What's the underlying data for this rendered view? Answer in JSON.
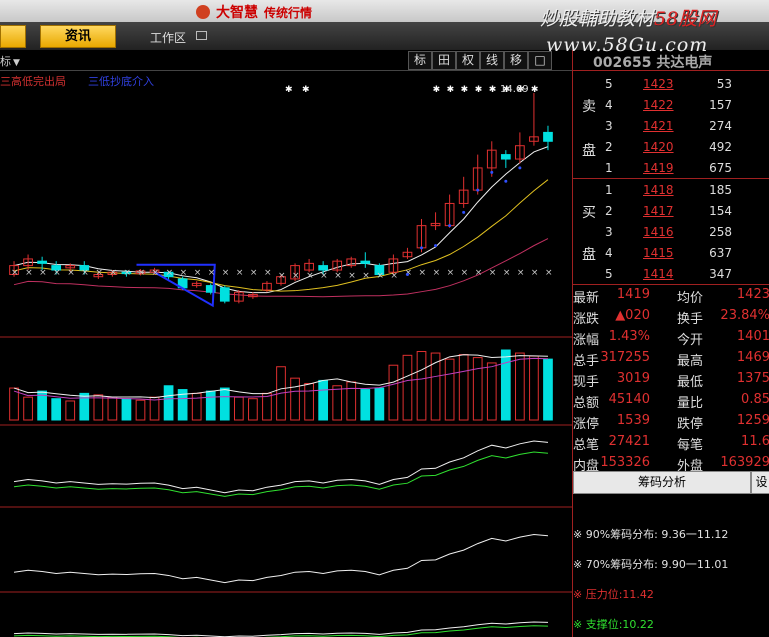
{
  "titlebar": {
    "brand": "大智慧",
    "subtitle": "传统行情"
  },
  "watermark": {
    "line1_a": "炒股輔助教材",
    "line1_b": "58股网",
    "line2": "www.58Gu.com"
  },
  "tabs": {
    "news": "资讯",
    "workzone": "工作区"
  },
  "chart_toolbar": {
    "label": "标",
    "buttons": [
      "标",
      "田",
      "权",
      "线",
      "移",
      "□"
    ]
  },
  "chart_legend": {
    "signal1": "三高低完出局",
    "signal2": "三低抄底介入"
  },
  "chart_annotation": "14.69",
  "colors": {
    "up": "#e03030",
    "down": "#00e0e0",
    "price_red": "#e03030",
    "panel_border": "#a02020"
  },
  "stock": {
    "code": "002655",
    "name": "共达电声"
  },
  "orderbook": {
    "sell_label": [
      "卖",
      "盘"
    ],
    "buy_label": [
      "买",
      "盘"
    ],
    "sell": [
      {
        "level": "5",
        "price": "1423",
        "volume": "53"
      },
      {
        "level": "4",
        "price": "1422",
        "volume": "157"
      },
      {
        "level": "3",
        "price": "1421",
        "volume": "274"
      },
      {
        "level": "2",
        "price": "1420",
        "volume": "492"
      },
      {
        "level": "1",
        "price": "1419",
        "volume": "675"
      }
    ],
    "buy": [
      {
        "level": "1",
        "price": "1418",
        "volume": "185"
      },
      {
        "level": "2",
        "price": "1417",
        "volume": "154"
      },
      {
        "level": "3",
        "price": "1416",
        "volume": "258"
      },
      {
        "level": "4",
        "price": "1415",
        "volume": "637"
      },
      {
        "level": "5",
        "price": "1414",
        "volume": "347"
      }
    ]
  },
  "quotes": [
    {
      "l1": "最新",
      "v1": "1419",
      "l2": "均价",
      "v2": "1423"
    },
    {
      "l1": "涨跌",
      "v1": "▲020",
      "l2": "换手",
      "v2": "23.84%"
    },
    {
      "l1": "涨幅",
      "v1": "1.43%",
      "l2": "今开",
      "v2": "1401"
    },
    {
      "l1": "总手",
      "v1": "317255",
      "l2": "最高",
      "v2": "1469"
    },
    {
      "l1": "现手",
      "v1": "3019",
      "l2": "最低",
      "v2": "1375"
    },
    {
      "l1": "总额",
      "v1": "45140",
      "l2": "量比",
      "v2": "0.85"
    },
    {
      "l1": "涨停",
      "v1": "1539",
      "l2": "跌停",
      "v2": "1259"
    },
    {
      "l1": "总笔",
      "v1": "27421",
      "l2": "每笔",
      "v2": "11.6"
    },
    {
      "l1": "内盘",
      "v1": "153326",
      "l2": "外盘",
      "v2": "163929"
    }
  ],
  "chip": {
    "tab": "筹码分析",
    "settings": "设",
    "lines": [
      {
        "text": "※ 90%筹码分布: 9.36一11.12",
        "color": "#e0e0e0"
      },
      {
        "text": "※ 70%筹码分布: 9.90一11.01",
        "color": "#e0e0e0"
      },
      {
        "text": "※ 压力位:11.42",
        "color": "#e03030"
      },
      {
        "text": "※ 支撑位:10.22",
        "color": "#30e030"
      }
    ]
  },
  "chart_data": {
    "type": "candlestick",
    "candles": [
      [
        10.6,
        10.8,
        10.55,
        10.9
      ],
      [
        10.8,
        10.95,
        10.7,
        11.05
      ],
      [
        10.9,
        10.85,
        10.7,
        11.0
      ],
      [
        10.8,
        10.7,
        10.6,
        10.9
      ],
      [
        10.75,
        10.8,
        10.65,
        10.85
      ],
      [
        10.8,
        10.7,
        10.6,
        10.9
      ],
      [
        10.55,
        10.6,
        10.5,
        10.65
      ],
      [
        10.6,
        10.65,
        10.55,
        10.7
      ],
      [
        10.65,
        10.62,
        10.55,
        10.7
      ],
      [
        10.62,
        10.68,
        10.58,
        10.72
      ],
      [
        10.65,
        10.7,
        10.6,
        10.75
      ],
      [
        10.65,
        10.55,
        10.45,
        10.68
      ],
      [
        10.5,
        10.3,
        10.25,
        10.55
      ],
      [
        10.35,
        10.4,
        10.3,
        10.45
      ],
      [
        10.35,
        10.2,
        10.15,
        10.4
      ],
      [
        10.3,
        10.0,
        9.95,
        10.35
      ],
      [
        10.0,
        10.2,
        9.95,
        10.25
      ],
      [
        10.1,
        10.15,
        10.05,
        10.2
      ],
      [
        10.25,
        10.4,
        10.2,
        10.45
      ],
      [
        10.4,
        10.55,
        10.35,
        10.6
      ],
      [
        10.5,
        10.8,
        10.45,
        10.85
      ],
      [
        10.7,
        10.85,
        10.65,
        10.95
      ],
      [
        10.8,
        10.7,
        10.6,
        10.9
      ],
      [
        10.7,
        10.9,
        10.65,
        10.95
      ],
      [
        10.8,
        10.95,
        10.75,
        11.0
      ],
      [
        10.9,
        10.85,
        10.75,
        11.1
      ],
      [
        10.8,
        10.6,
        10.55,
        10.85
      ],
      [
        10.65,
        10.95,
        10.6,
        11.05
      ],
      [
        11.0,
        11.1,
        10.95,
        11.2
      ],
      [
        11.2,
        11.7,
        11.1,
        11.85
      ],
      [
        11.7,
        11.75,
        11.6,
        12.0
      ],
      [
        11.7,
        12.2,
        11.65,
        12.4
      ],
      [
        12.2,
        12.5,
        12.1,
        12.8
      ],
      [
        12.5,
        13.0,
        12.4,
        13.3
      ],
      [
        13.0,
        13.4,
        12.8,
        13.6
      ],
      [
        13.3,
        13.2,
        13.0,
        13.4
      ],
      [
        13.2,
        13.5,
        13.1,
        13.8
      ],
      [
        13.6,
        13.7,
        13.5,
        14.69
      ],
      [
        13.8,
        13.6,
        13.4,
        13.95
      ]
    ],
    "volumes": [
      42,
      30,
      38,
      28,
      25,
      35,
      33,
      30,
      28,
      26,
      30,
      45,
      40,
      35,
      38,
      42,
      30,
      28,
      35,
      70,
      55,
      48,
      52,
      45,
      50,
      40,
      42,
      72,
      85,
      90,
      88,
      80,
      86,
      82,
      75,
      92,
      88,
      84,
      80
    ],
    "price_range": [
      9.8,
      14.8
    ]
  }
}
